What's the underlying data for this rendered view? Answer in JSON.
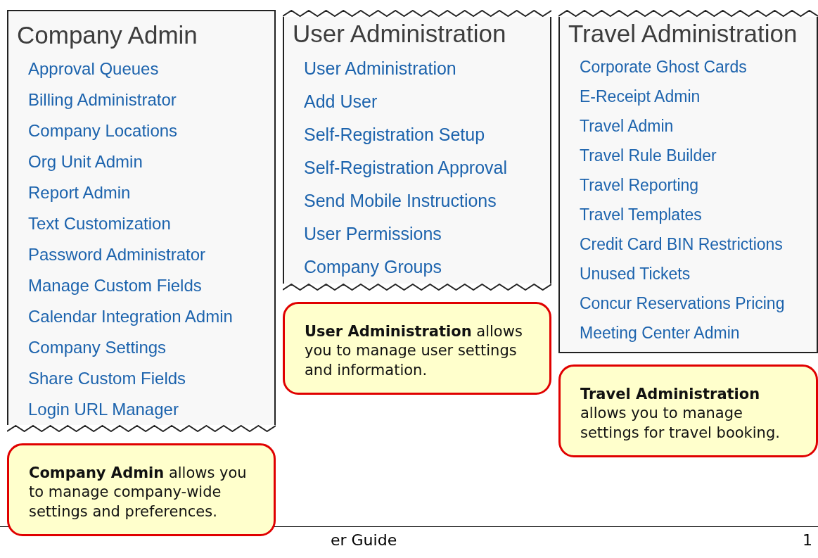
{
  "panels": [
    {
      "title": "Company Admin",
      "torn_top": false,
      "torn_bottom": true,
      "links": [
        "Approval Queues",
        "Billing Administrator",
        "Company Locations",
        "Org Unit Admin",
        "Report Admin",
        "Text Customization",
        "Password Administrator",
        "Manage Custom Fields",
        "Calendar Integration Admin",
        "Company Settings",
        "Share Custom Fields",
        "Login URL Manager"
      ],
      "callout": "**Company Admin** allows you to manage company-wide settings and preferences."
    },
    {
      "title": "User Administration",
      "torn_top": true,
      "torn_bottom": true,
      "links": [
        "User Administration",
        "Add User",
        "Self-Registration Setup",
        "Self-Registration Approval",
        "Send Mobile Instructions",
        "User Permissions",
        "Company Groups"
      ],
      "callout": "**User Administration** allows you to manage user settings and information."
    },
    {
      "title": "Travel Administration",
      "torn_top": true,
      "torn_bottom": false,
      "links": [
        "Corporate Ghost Cards",
        "E-Receipt Admin",
        "Travel Admin",
        "Travel Rule Builder",
        "Travel Reporting",
        "Travel Templates",
        "Credit Card BIN Restrictions",
        "Unused Tickets",
        "Concur Reservations Pricing",
        "Meeting Center Admin"
      ],
      "callout": "**Travel Administration** allows you to manage settings for travel booking."
    }
  ],
  "footer": {
    "title": "er Guide",
    "page": "1"
  }
}
